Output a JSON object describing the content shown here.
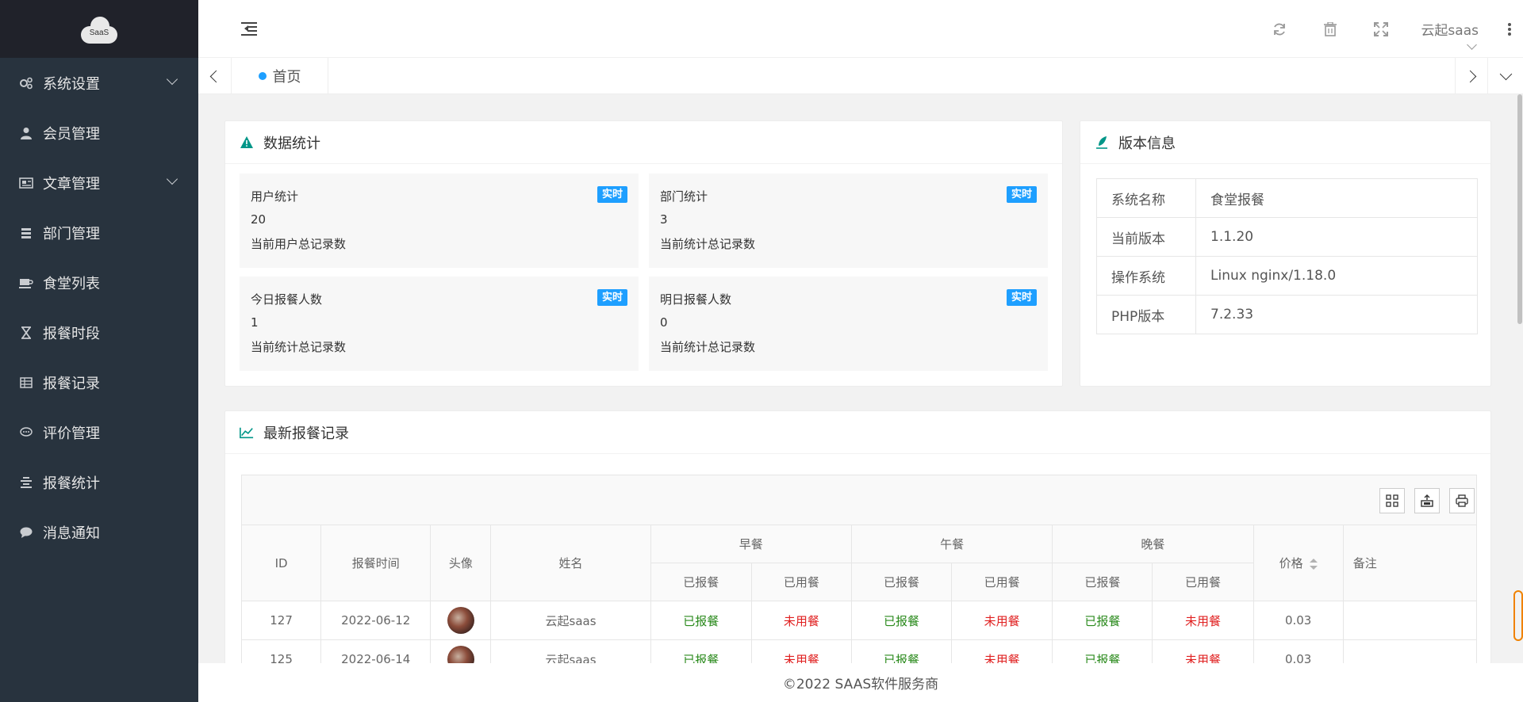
{
  "app": {
    "logo_text": "SaaS"
  },
  "sidebar": {
    "items": [
      {
        "label": "系统设置",
        "icon": "gears-icon",
        "has_submenu": true
      },
      {
        "label": "会员管理",
        "icon": "user-icon",
        "has_submenu": false
      },
      {
        "label": "文章管理",
        "icon": "newspaper-icon",
        "has_submenu": true
      },
      {
        "label": "部门管理",
        "icon": "list-icon",
        "has_submenu": false
      },
      {
        "label": "食堂列表",
        "icon": "coffee-icon",
        "has_submenu": false
      },
      {
        "label": "报餐时段",
        "icon": "hourglass-icon",
        "has_submenu": false
      },
      {
        "label": "报餐记录",
        "icon": "table-icon",
        "has_submenu": false
      },
      {
        "label": "评价管理",
        "icon": "comment-dots-icon",
        "has_submenu": false
      },
      {
        "label": "报餐统计",
        "icon": "align-center-icon",
        "has_submenu": false
      },
      {
        "label": "消息通知",
        "icon": "comment-icon",
        "has_submenu": false
      }
    ]
  },
  "header": {
    "user_name": "云起saas",
    "icons": [
      "refresh-icon",
      "trash-icon",
      "fullscreen-icon",
      "more-vertical-icon"
    ]
  },
  "tabs": {
    "active_label": "首页"
  },
  "stats_card": {
    "title": "数据统计",
    "items": [
      {
        "label": "用户统计",
        "badge": "实时",
        "value": "20",
        "desc": "当前用户总记录数"
      },
      {
        "label": "部门统计",
        "badge": "实时",
        "value": "3",
        "desc": "当前统计总记录数"
      },
      {
        "label": "今日报餐人数",
        "badge": "实时",
        "value": "1",
        "desc": "当前统计总记录数"
      },
      {
        "label": "明日报餐人数",
        "badge": "实时",
        "value": "0",
        "desc": "当前统计总记录数"
      }
    ]
  },
  "version_card": {
    "title": "版本信息",
    "rows": [
      {
        "key": "系统名称",
        "value": "食堂报餐"
      },
      {
        "key": "当前版本",
        "value": "1.1.20"
      },
      {
        "key": "操作系统",
        "value": "Linux nginx/1.18.0"
      },
      {
        "key": "PHP版本",
        "value": "7.2.33"
      }
    ]
  },
  "records_card": {
    "title": "最新报餐记录",
    "toolbar_icons": [
      "columns-icon",
      "export-icon",
      "print-icon"
    ],
    "headers": {
      "id": "ID",
      "time": "报餐时间",
      "avatar": "头像",
      "name": "姓名",
      "breakfast": "早餐",
      "lunch": "午餐",
      "dinner": "晚餐",
      "reported": "已报餐",
      "used": "已用餐",
      "price": "价格",
      "remark": "备注"
    },
    "rows": [
      {
        "id": "127",
        "time": "2022-06-12",
        "name": "云起saas",
        "b_rep": "已报餐",
        "b_use": "未用餐",
        "l_rep": "已报餐",
        "l_use": "未用餐",
        "d_rep": "已报餐",
        "d_use": "未用餐",
        "price": "0.03",
        "remark": ""
      },
      {
        "id": "125",
        "time": "2022-06-14",
        "name": "云起saas",
        "b_rep": "已报餐",
        "b_use": "未用餐",
        "l_rep": "已报餐",
        "l_use": "未用餐",
        "d_rep": "已报餐",
        "d_use": "未用餐",
        "price": "0.03",
        "remark": ""
      }
    ]
  },
  "footer": {
    "text": "©2022 SAAS软件服务商"
  }
}
